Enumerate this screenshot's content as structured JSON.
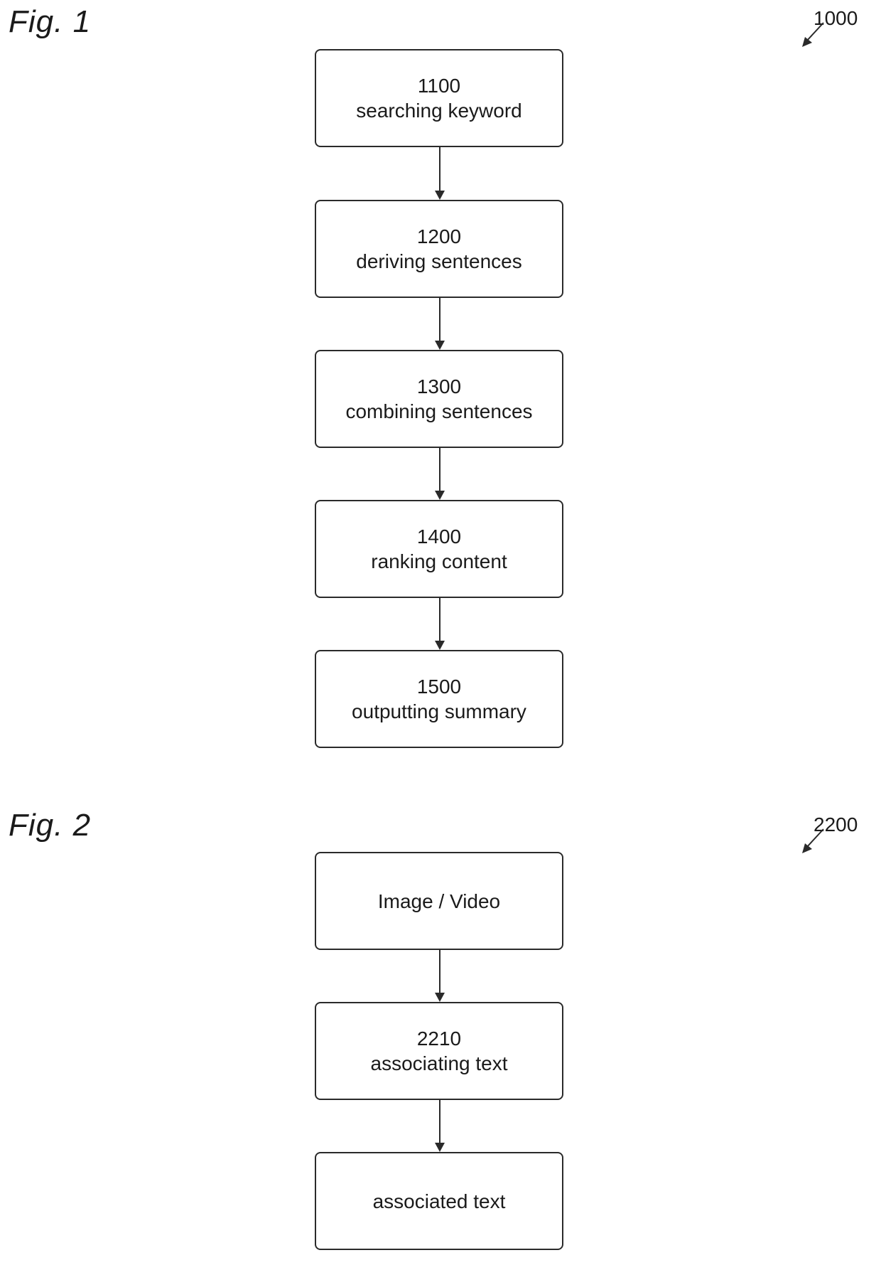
{
  "figures": [
    {
      "label": "Fig. 1",
      "reference": "1000",
      "steps": [
        {
          "number": "1100",
          "text": "searching keyword"
        },
        {
          "number": "1200",
          "text": "deriving sentences"
        },
        {
          "number": "1300",
          "text": "combining sentences"
        },
        {
          "number": "1400",
          "text": "ranking content"
        },
        {
          "number": "1500",
          "text": "outputting summary"
        }
      ]
    },
    {
      "label": "Fig. 2",
      "reference": "2200",
      "steps": [
        {
          "number": "",
          "text": "Image / Video"
        },
        {
          "number": "2210",
          "text": "associating text"
        },
        {
          "number": "",
          "text": "associated text"
        }
      ]
    }
  ],
  "colors": {
    "line": "#2a2a2a",
    "text": "#1a1a1a",
    "background": "#ffffff"
  }
}
